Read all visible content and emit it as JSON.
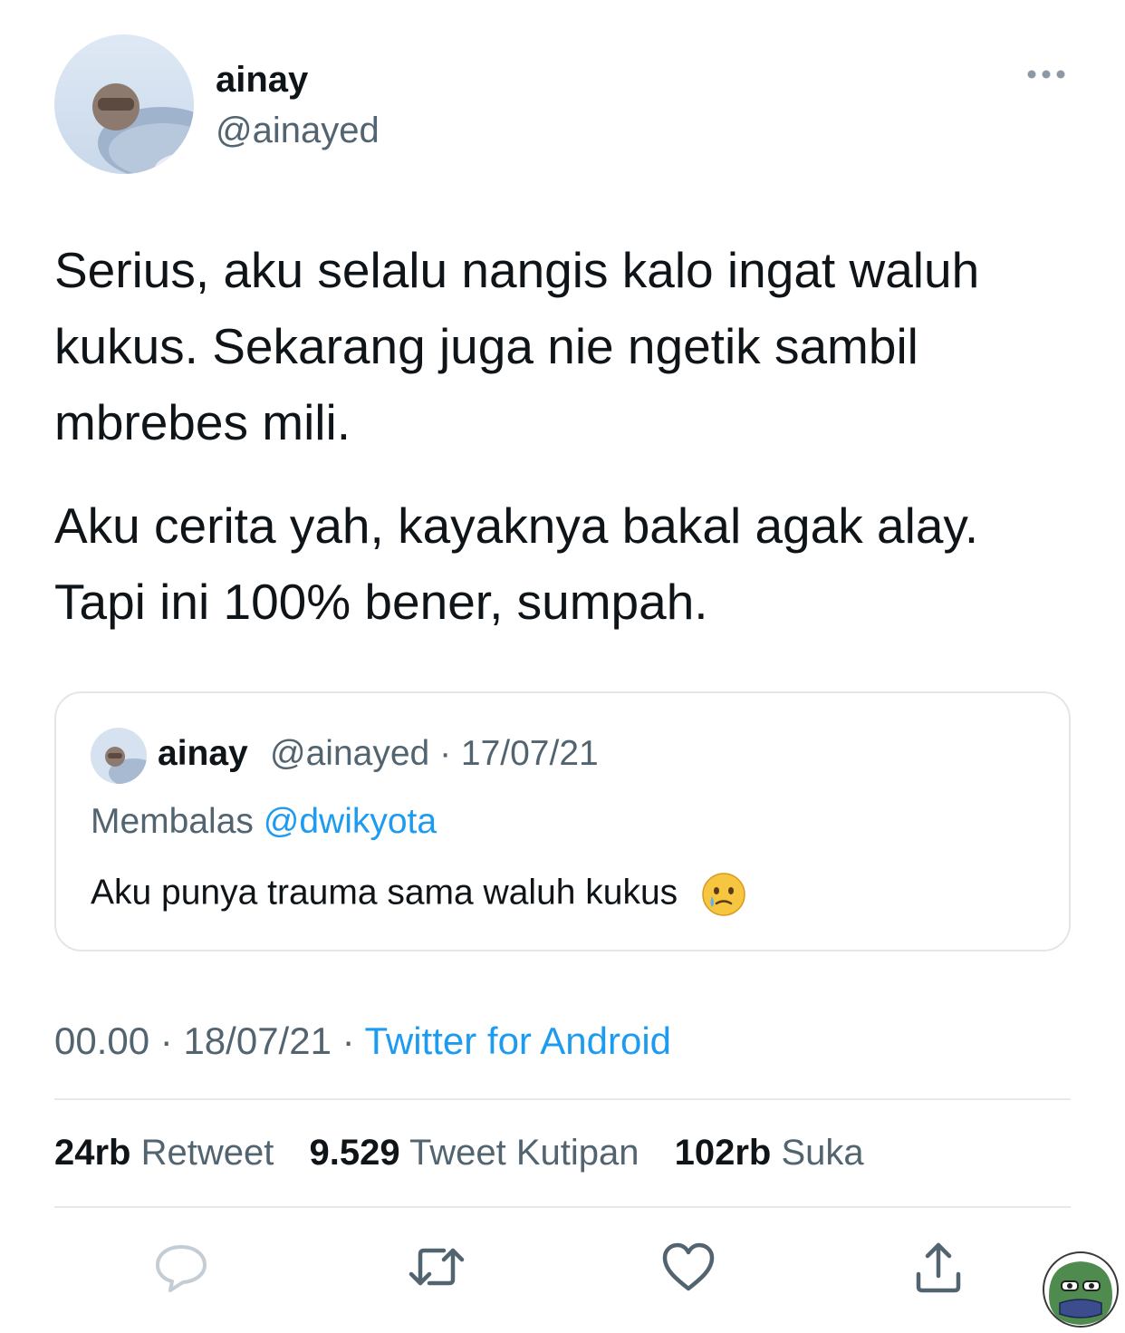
{
  "author": {
    "name": "ainay",
    "handle": "@ainayed"
  },
  "tweet": {
    "paragraphs": [
      "Serius, aku selalu nangis kalo ingat waluh kukus. Sekarang juga nie ngetik sambil mbrebes mili.",
      "Aku cerita yah, kayaknya bakal agak alay. Tapi ini 100% bener, sumpah."
    ]
  },
  "quoted_tweet": {
    "name": "ainay",
    "handle": "@ainayed",
    "separator": "·",
    "date": "17/07/21",
    "reply_prefix": "Membalas",
    "reply_mention": "@dwikyota",
    "text": "Aku punya trauma sama waluh kukus",
    "emoji_icon": "face-holding-back-tears-icon"
  },
  "meta": {
    "time": "00.00",
    "separator": "·",
    "date": "18/07/21",
    "source": "Twitter for Android"
  },
  "stats": {
    "retweets_count": "24rb",
    "retweets_label": "Retweet",
    "quotes_count": "9.529",
    "quotes_label": "Tweet Kutipan",
    "likes_count": "102rb",
    "likes_label": "Suka"
  },
  "actions": [
    "reply-icon",
    "retweet-icon",
    "like-icon",
    "share-icon"
  ],
  "icons": {
    "more": "more-dots-icon",
    "watermark": "frog-face-icon"
  },
  "colors": {
    "text": "#0f1419",
    "secondary": "#536471",
    "accent": "#1d9bf0",
    "border": "#e6e9ec"
  }
}
